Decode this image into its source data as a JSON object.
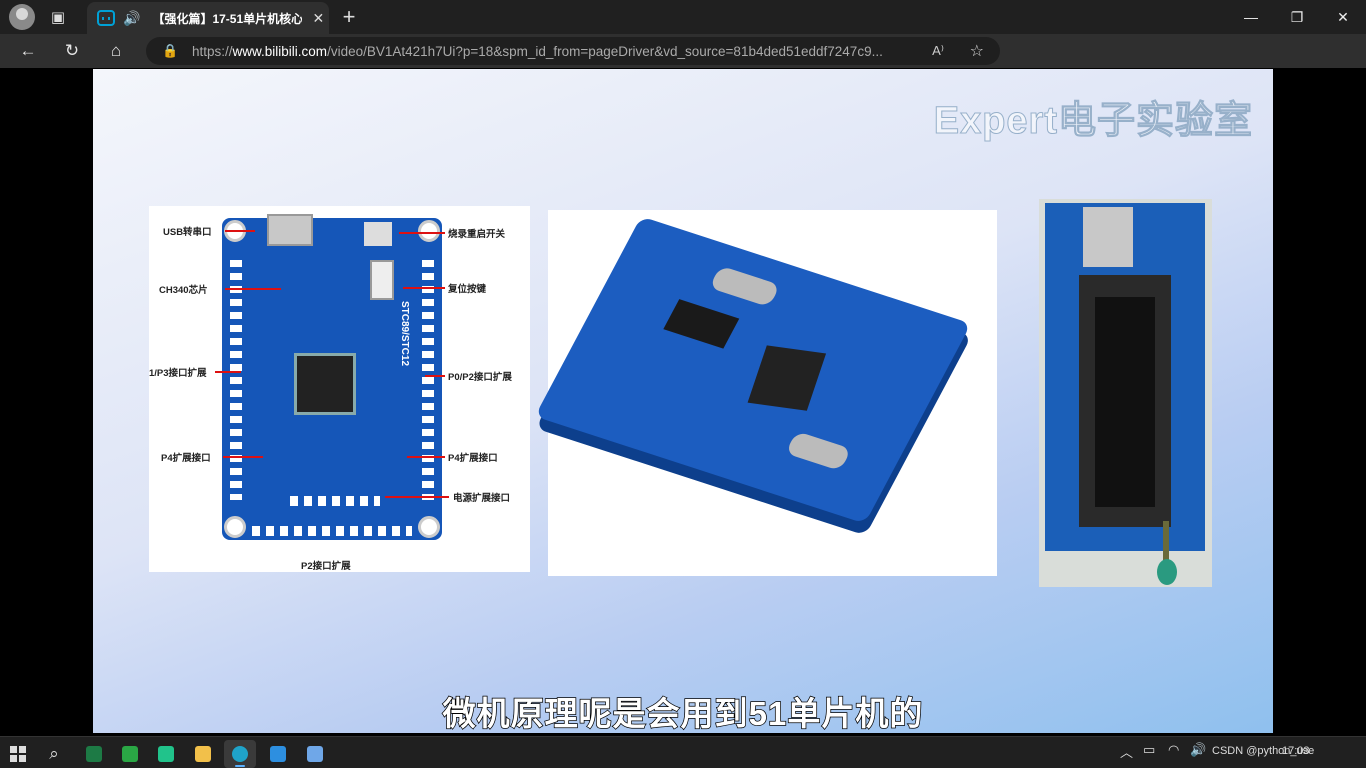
{
  "tab": {
    "title": "【强化篇】17-51单片机核心",
    "audio_icon": "speaker-icon",
    "close": "✕"
  },
  "window": {
    "minimize": "—",
    "maximize": "❐",
    "close": "✕"
  },
  "address": {
    "url_prefix": "https://",
    "url_host": "www.bilibili.com",
    "url_path": "/video/BV1At421h7Ui?p=18&spm_id_from=pageDriver&vd_source=81b4ded51eddf7247c9...",
    "read_aloud": "A⁾"
  },
  "video": {
    "watermark": "Expert电子实验室",
    "subtitle": "微机原理呢是会用到51单片机的",
    "board1_labels": {
      "usb": "USB转串口",
      "switch": "烧录重启开关",
      "ch340": "CH340芯片",
      "reset": "复位按键",
      "p1p3": "1/P3接口扩展",
      "p0p2": "P0/P2接口扩展",
      "p4_left": "P4扩展接口",
      "p4_right": "P4扩展接口",
      "power": "电源扩展接口",
      "p2": "P2接口扩展",
      "chip_text": "STC89/STC12"
    }
  },
  "taskbar": {
    "tray_text": "CSDN @python_use",
    "time": "17:03"
  },
  "colors": {
    "accent": "#00a1d6",
    "board_blue": "#1556b8"
  }
}
